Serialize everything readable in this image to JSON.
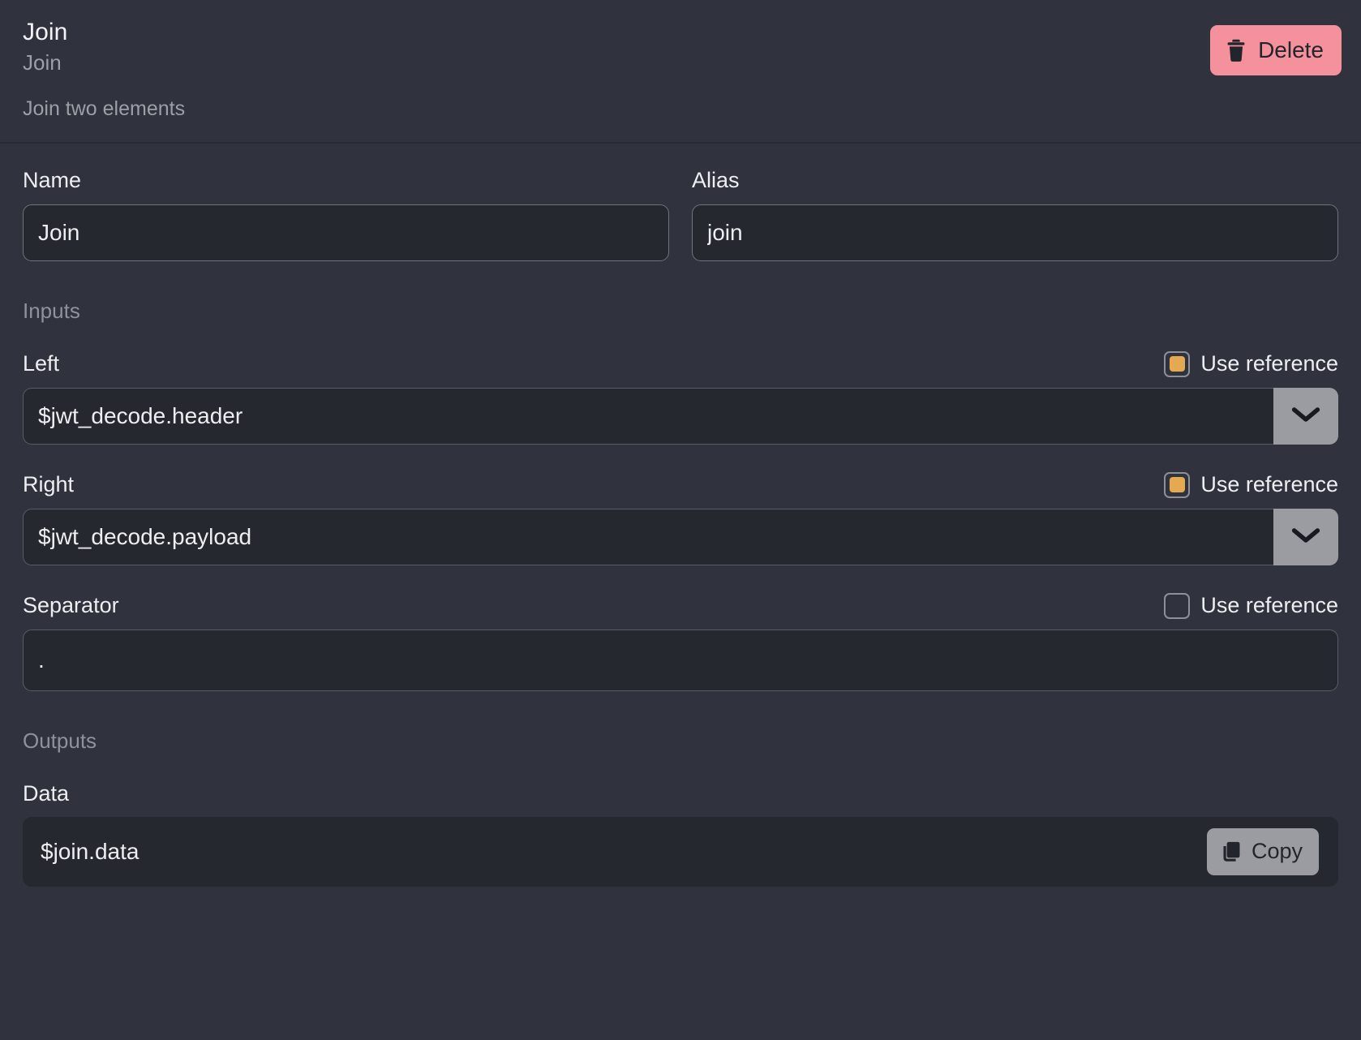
{
  "header": {
    "title": "Join",
    "subtitle": "Join",
    "description": "Join two elements",
    "delete_label": "Delete",
    "delete_color": "#f4919d",
    "delete_icon": "trash-icon"
  },
  "fields": {
    "name_label": "Name",
    "name_value": "Join",
    "alias_label": "Alias",
    "alias_value": "join"
  },
  "sections": {
    "inputs_label": "Inputs",
    "outputs_label": "Outputs"
  },
  "use_reference_label": "Use reference",
  "checkbox_accent": "#e5a952",
  "inputs": [
    {
      "label": "Left",
      "value": "$jwt_decode.header",
      "use_reference": true,
      "control": "select",
      "chevron_icon": "chevron-down-icon"
    },
    {
      "label": "Right",
      "value": "$jwt_decode.payload",
      "use_reference": true,
      "control": "select",
      "chevron_icon": "chevron-down-icon"
    },
    {
      "label": "Separator",
      "value": ".",
      "use_reference": false,
      "control": "text"
    }
  ],
  "outputs": [
    {
      "label": "Data",
      "value": "$join.data",
      "copy_label": "Copy",
      "copy_icon": "copy-icon"
    }
  ]
}
